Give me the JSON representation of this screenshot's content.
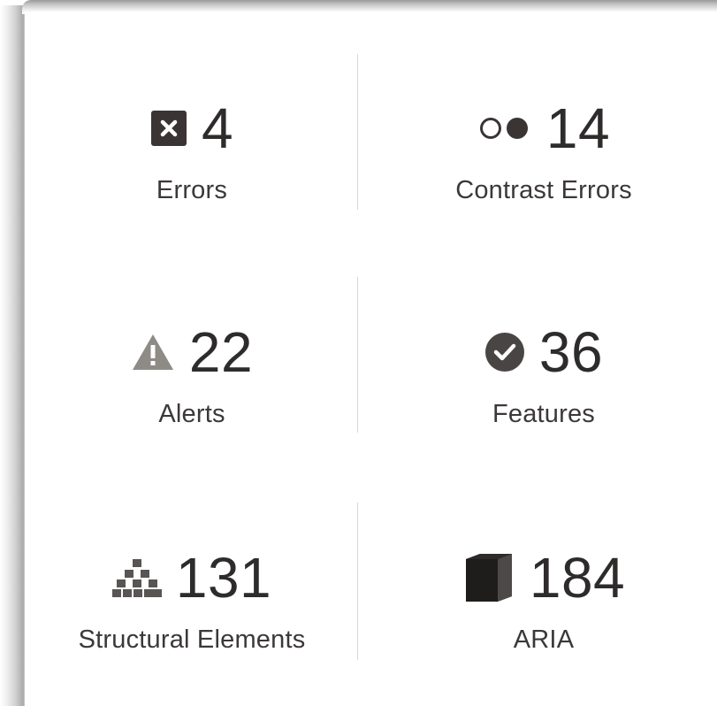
{
  "stats": [
    {
      "value": "4",
      "label": "Errors",
      "icon": "error-x-icon"
    },
    {
      "value": "14",
      "label": "Contrast Errors",
      "icon": "contrast-icon"
    },
    {
      "value": "22",
      "label": "Alerts",
      "icon": "alert-triangle-icon"
    },
    {
      "value": "36",
      "label": "Features",
      "icon": "checkmark-circle-icon"
    },
    {
      "value": "131",
      "label": "Structural Elements",
      "icon": "hierarchy-icon"
    },
    {
      "value": "184",
      "label": "ARIA",
      "icon": "aria-cube-icon"
    }
  ],
  "colors": {
    "text": "#2e2b2b",
    "icon_dark": "#3a3434",
    "icon_gray": "#8e8a86",
    "divider": "#d8d8d8"
  }
}
